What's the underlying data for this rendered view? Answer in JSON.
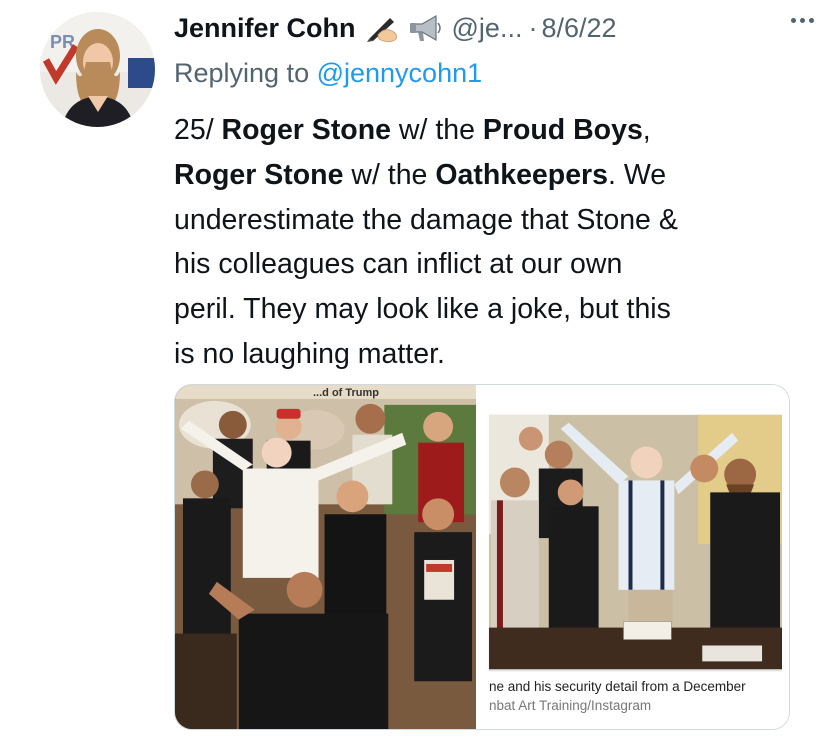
{
  "author": {
    "name": "Jennifer Cohn",
    "emoji": [
      "writing-hand",
      "megaphone"
    ],
    "handle": "@je...",
    "separator": "·",
    "date": "8/6/22",
    "avatar_text": "PR"
  },
  "reply": {
    "prefix": "Replying to ",
    "mention": "@jennycohn1"
  },
  "tweet": {
    "line1_a": "25/ ",
    "line1_b": "Roger Stone",
    "line1_c": " w/ the ",
    "line1_d": "Proud Boys",
    "line1_e": ",",
    "line2_a": "Roger Stone",
    "line2_b": " w/ the ",
    "line2_c": "Oathkeepers",
    "line2_d": ". We",
    "line3": "underestimate the damage that Stone &",
    "line4": "his colleagues can inflict at our own",
    "line5": "peril. They may look like a joke, but this",
    "line6": "is no laughing matter."
  },
  "media": {
    "left_banner": "...d of Trump",
    "right_caption_1": "ne and his security detail from a December",
    "right_caption_2": "nbat Art Training/Instagram"
  },
  "colors": {
    "link": "#1d9bf0",
    "secondary": "#536471",
    "text": "#0f1419"
  }
}
